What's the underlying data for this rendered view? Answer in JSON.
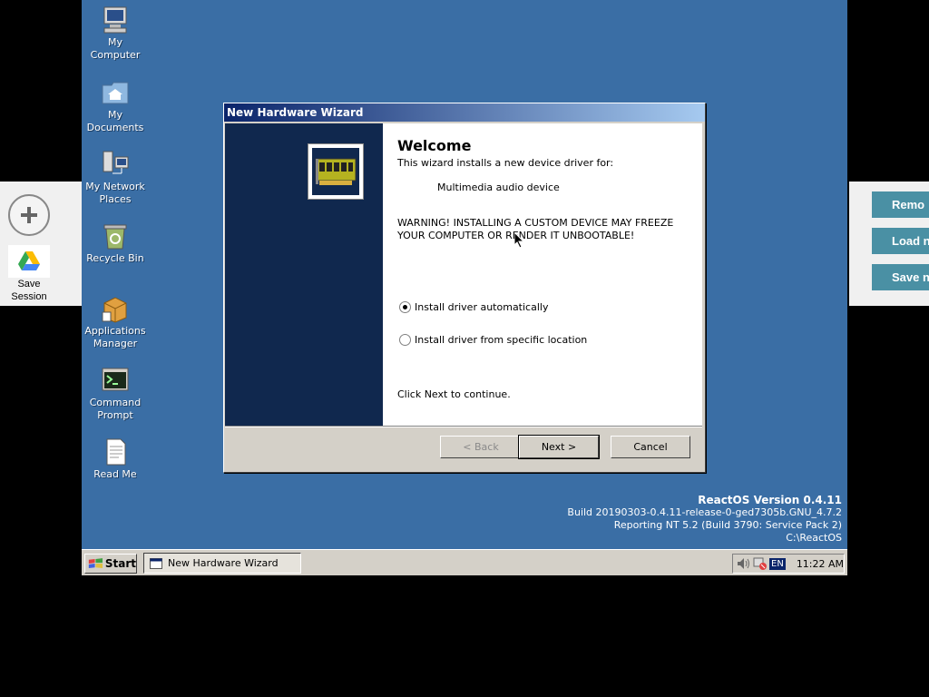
{
  "desktop": {
    "icons": [
      {
        "label_line1": "My",
        "label_line2": "Computer",
        "icon": "computer-icon"
      },
      {
        "label_line1": "My",
        "label_line2": "Documents",
        "icon": "folder-icon"
      },
      {
        "label_line1": "My Network",
        "label_line2": "Places",
        "icon": "network-icon"
      },
      {
        "label_line1": "Recycle Bin",
        "label_line2": "",
        "icon": "recycle-bin-icon"
      },
      {
        "label_line1": "Applications",
        "label_line2": "Manager",
        "icon": "package-icon"
      },
      {
        "label_line1": "Command",
        "label_line2": "Prompt",
        "icon": "terminal-icon"
      },
      {
        "label_line1": "Read Me",
        "label_line2": "",
        "icon": "document-icon"
      }
    ],
    "background_color": "#3a6ea5"
  },
  "version_info": {
    "title": "ReactOS Version 0.4.11",
    "build": "Build 20190303-0.4.11-release-0-ged7305b.GNU_4.7.2",
    "reporting": "Reporting NT 5.2 (Build 3790: Service Pack 2)",
    "path": "C:\\ReactOS"
  },
  "dialog": {
    "title": "New Hardware Wizard",
    "heading": "Welcome",
    "intro": "This wizard installs a new device driver for:",
    "device": "Multimedia audio device",
    "warning_line1": "WARNING! INSTALLING A CUSTOM DEVICE MAY FREEZE",
    "warning_line2": "YOUR COMPUTER OR RENDER IT UNBOOTABLE!",
    "option_auto": "Install driver automatically",
    "option_specific": "Install driver from specific location",
    "selected_option": "auto",
    "continue_text": "Click Next to continue.",
    "back_label": "< Back",
    "next_label": "Next >",
    "cancel_label": "Cancel"
  },
  "taskbar": {
    "start_label": "Start",
    "task_label": "New Hardware Wizard",
    "lang": "EN",
    "clock": "11:22 AM"
  },
  "left_panel": {
    "save_session_line1": "Save",
    "save_session_line2": "Session"
  },
  "right_panel": {
    "btn1": "Remo",
    "btn2": "Load n",
    "btn3": "Save n"
  }
}
